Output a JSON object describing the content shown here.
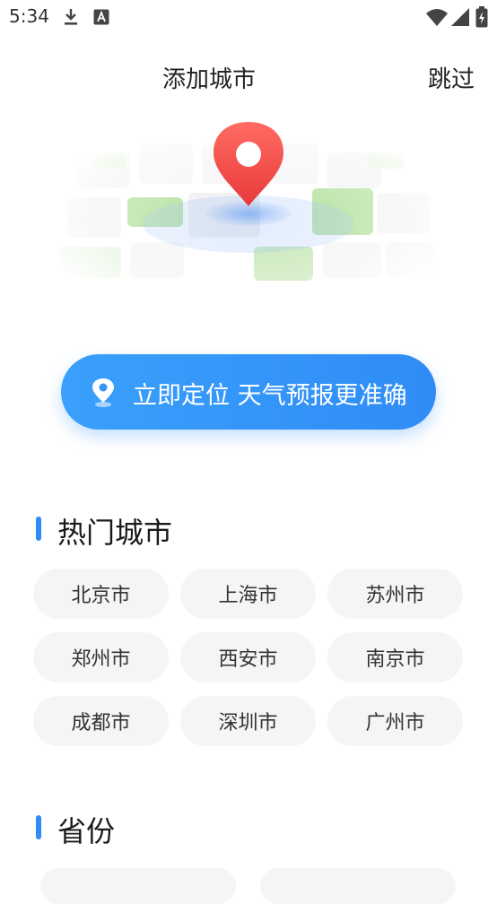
{
  "status_bar": {
    "time": "5:34"
  },
  "header": {
    "title": "添加城市",
    "skip": "跳过"
  },
  "locate": {
    "label": "立即定位 天气预报更准确"
  },
  "hot_cities": {
    "title": "热门城市",
    "items": [
      "北京市",
      "上海市",
      "苏州市",
      "郑州市",
      "西安市",
      "南京市",
      "成都市",
      "深圳市",
      "广州市"
    ]
  },
  "provinces": {
    "title": "省份"
  },
  "colors": {
    "accent": "#2f8cf6",
    "pin": "#f04a48",
    "chip_bg": "#f4f5f7",
    "green_tile": "#a9dc8f"
  },
  "icons": [
    "download-icon",
    "a-icon",
    "wifi-icon",
    "signal-icon",
    "battery-icon",
    "location-pin-icon"
  ]
}
